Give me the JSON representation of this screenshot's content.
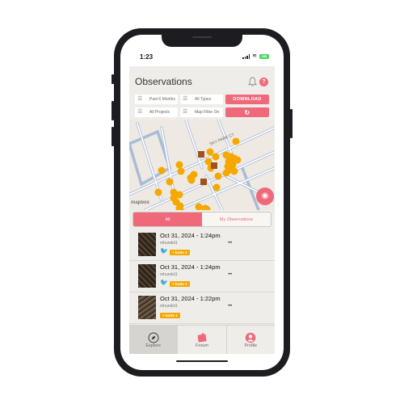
{
  "status_bar": {
    "time": "1:23",
    "battery": "GB"
  },
  "header": {
    "title": "Observations",
    "bell_icon": "bell-icon",
    "help_label": "?"
  },
  "filters": {
    "time_range": "Past 6 Months",
    "types": "All Types",
    "projects": "All Projects",
    "map_filter": "Map Filter On",
    "download_label": "DOWNLOAD",
    "refresh_icon": "↻"
  },
  "map": {
    "street_label": "SKY PARK CT",
    "attribution": "mapbox",
    "locate_icon": "⌖",
    "eye_icon": "👁"
  },
  "segments": {
    "all": "All",
    "mine": "My Observations"
  },
  "observations": [
    {
      "date": "Oct 31, 2024 - 1:24pm",
      "user": "mhundol1",
      "more": "•••",
      "tag": "+ butte 1",
      "has_bird": true
    },
    {
      "date": "Oct 31, 2024 - 1:24pm",
      "user": "mhundol1",
      "more": "•••",
      "tag": "+ butte 1",
      "has_bird": true
    },
    {
      "date": "Oct 31, 2024 - 1:22pm",
      "user": "mhundol1",
      "more": "•••",
      "tag": "+ butte 1",
      "has_bird": false
    }
  ],
  "tabs": [
    {
      "label": "Explore",
      "icon": "compass-icon",
      "glyph": "🧭",
      "active": true
    },
    {
      "label": "Forum",
      "icon": "forum-icon",
      "glyph": "📌",
      "active": false
    },
    {
      "label": "Profile",
      "icon": "profile-icon",
      "glyph": "👤",
      "active": false
    }
  ],
  "colors": {
    "accent": "#f0697b",
    "tag": "#f5a800",
    "marker": "#f5a800",
    "marker_alt": "#a0521c"
  }
}
